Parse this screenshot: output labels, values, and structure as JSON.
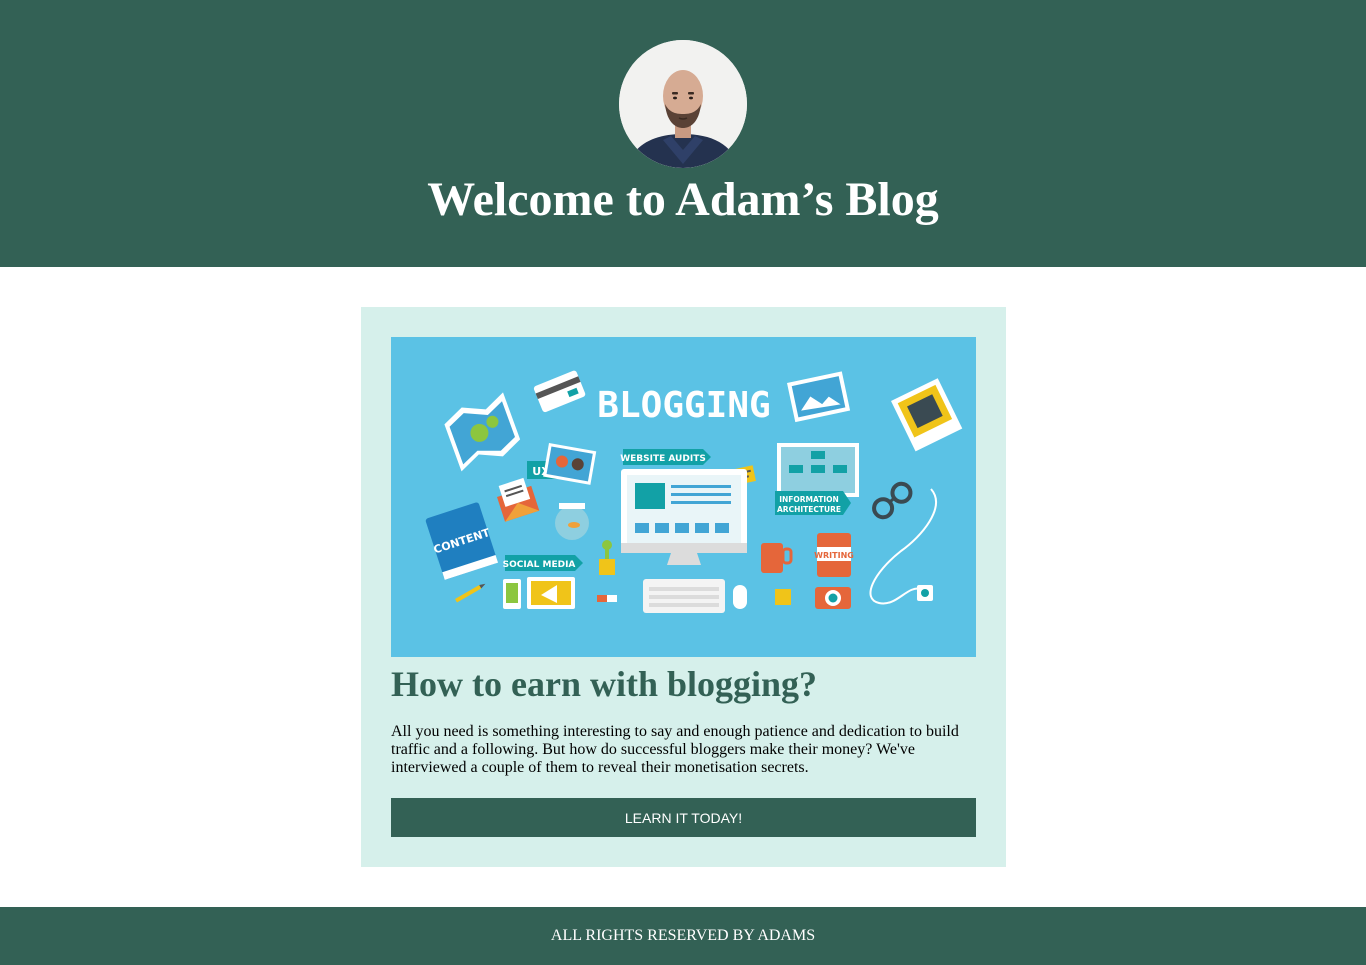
{
  "header": {
    "title": "Welcome to Adam’s Blog",
    "avatar_icon": "profile-photo",
    "background_color": "#336155"
  },
  "post": {
    "image_text": {
      "heading": "BLOGGING",
      "website_audits": "WEBSITE AUDITS",
      "ux": "UX",
      "content": "CONTENT",
      "social_media": "SOCIAL MEDIA",
      "information": "INFORMATION",
      "architecture": "ARCHITECTURE",
      "writing": "WRITING"
    },
    "title": "How to earn with blogging?",
    "body": "All you need is something interesting to say and enough patience and dedication to build traffic and a following. But how do successful bloggers make their money? We've interviewed a couple of them to reveal their monetisation secrets.",
    "button_label": "LEARN IT TODAY!",
    "card_background": "#d6f0eb",
    "image_background": "#5bc2e5"
  },
  "footer": {
    "text": "ALL RIGHTS RESERVED BY ADAMS"
  }
}
